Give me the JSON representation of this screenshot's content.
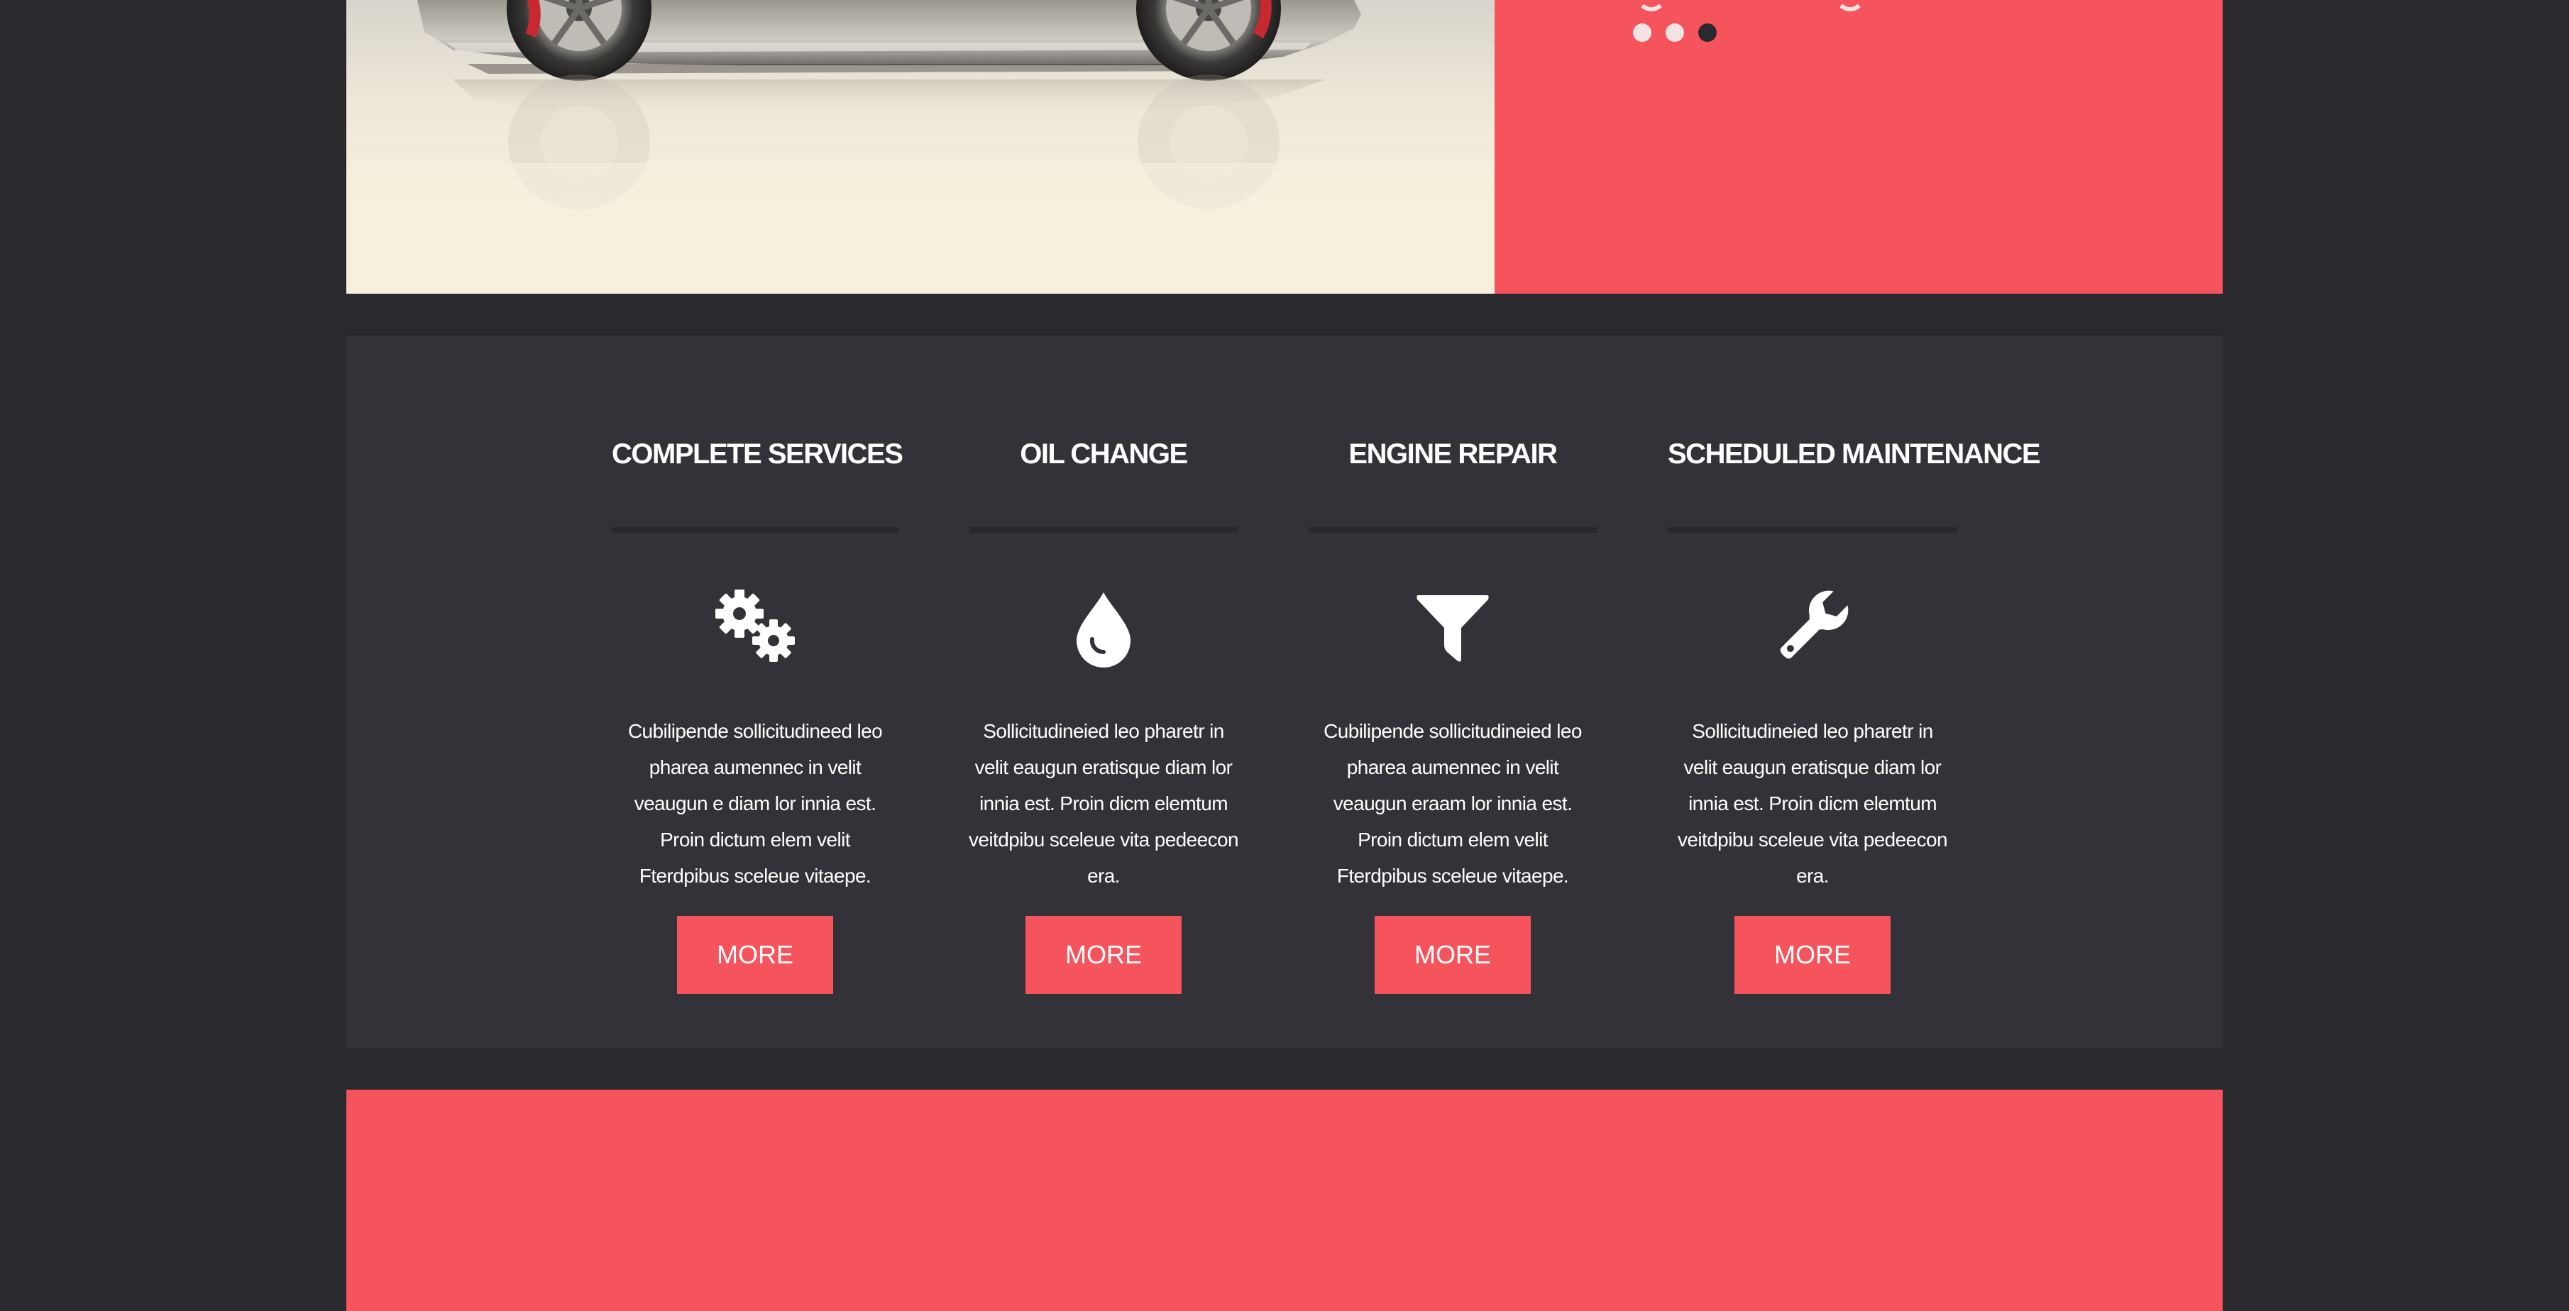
{
  "hero": {
    "slider_dots": [
      {
        "active": false
      },
      {
        "active": false
      },
      {
        "active": true
      }
    ]
  },
  "services": [
    {
      "title": "COMPLETE SERVICES",
      "icon": "gears-icon",
      "text": "Cubilipende sollicitudineed leo pharea aumennec in velit veaugun e diam lor innia est. Proin dictum elem velit Fterdpibus sceleue vitaepe.",
      "button": "MORE"
    },
    {
      "title": "OIL CHANGE",
      "icon": "oil-drop-icon",
      "text": "Sollicitudineied leo pharetr in velit eaugun eratisque diam lor innia est. Proin dicm elemtum veitdpibu sceleue vita pedeecon era.",
      "button": "MORE"
    },
    {
      "title": "ENGINE REPAIR",
      "icon": "funnel-icon",
      "text": "Cubilipende sollicitudineied leo pharea aumennec in velit veaugun eraam lor innia est. Proin dictum elem velit Fterdpibus sceleue vitaepe.",
      "button": "MORE"
    },
    {
      "title": "SCHEDULED MAINTENANCE",
      "icon": "wrench-icon",
      "text": "Sollicitudineied leo pharetr in velit eaugun eratisque diam lor innia est. Proin dicm elemtum veitdpibu sceleue vita pedeecon era.",
      "button": "MORE"
    }
  ],
  "colors": {
    "page_background": "#2a292e",
    "section_background": "#333238",
    "accent": "#f6545c",
    "text": "#ffffff"
  }
}
